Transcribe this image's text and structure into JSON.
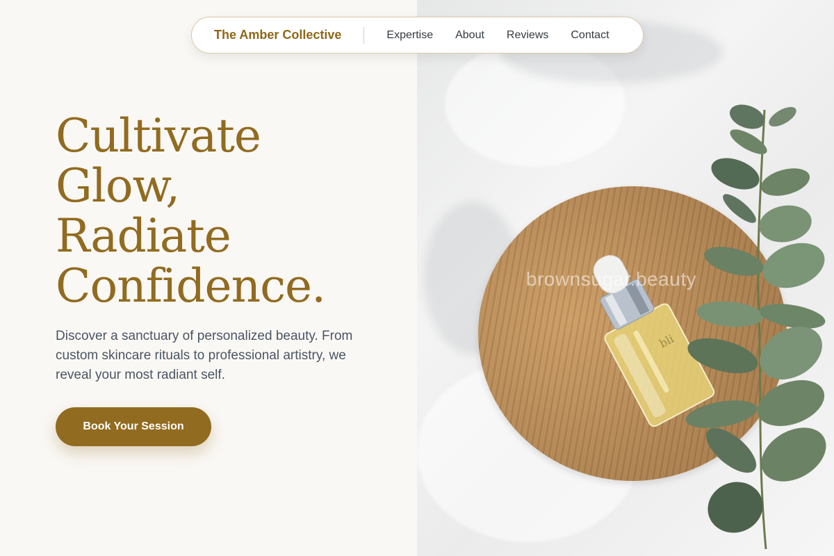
{
  "nav": {
    "brand": "The Amber Collective",
    "links": [
      "Expertise",
      "About",
      "Reviews",
      "Contact"
    ]
  },
  "hero": {
    "headline_lines": [
      "Cultivate",
      "Glow,",
      "Radiate",
      "Confidence."
    ],
    "subtext": "Discover a sanctuary of personalized beauty. From custom skincare rituals to professional artistry, we reveal your most radiant self.",
    "cta_label": "Book Your Session"
  },
  "image": {
    "watermark": "brownsugar.beauty",
    "bottle_label": "bli"
  },
  "colors": {
    "accent": "#916b1f",
    "background": "#faf8f5",
    "text": "#4a5563"
  }
}
